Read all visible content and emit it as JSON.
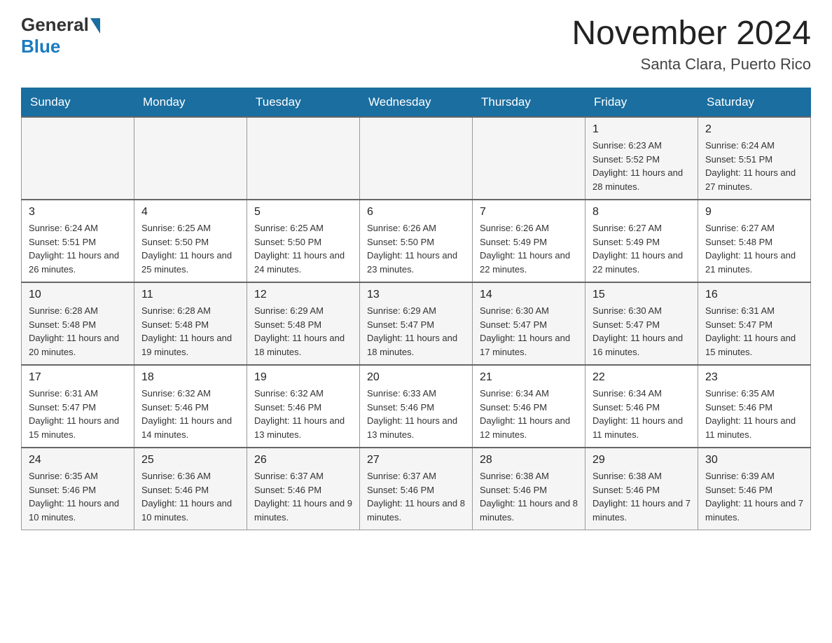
{
  "header": {
    "logo": {
      "general": "General",
      "blue": "Blue"
    },
    "title": "November 2024",
    "location": "Santa Clara, Puerto Rico"
  },
  "calendar": {
    "days_of_week": [
      "Sunday",
      "Monday",
      "Tuesday",
      "Wednesday",
      "Thursday",
      "Friday",
      "Saturday"
    ],
    "weeks": [
      {
        "days": [
          {
            "num": "",
            "info": ""
          },
          {
            "num": "",
            "info": ""
          },
          {
            "num": "",
            "info": ""
          },
          {
            "num": "",
            "info": ""
          },
          {
            "num": "",
            "info": ""
          },
          {
            "num": "1",
            "info": "Sunrise: 6:23 AM\nSunset: 5:52 PM\nDaylight: 11 hours and 28 minutes."
          },
          {
            "num": "2",
            "info": "Sunrise: 6:24 AM\nSunset: 5:51 PM\nDaylight: 11 hours and 27 minutes."
          }
        ]
      },
      {
        "days": [
          {
            "num": "3",
            "info": "Sunrise: 6:24 AM\nSunset: 5:51 PM\nDaylight: 11 hours and 26 minutes."
          },
          {
            "num": "4",
            "info": "Sunrise: 6:25 AM\nSunset: 5:50 PM\nDaylight: 11 hours and 25 minutes."
          },
          {
            "num": "5",
            "info": "Sunrise: 6:25 AM\nSunset: 5:50 PM\nDaylight: 11 hours and 24 minutes."
          },
          {
            "num": "6",
            "info": "Sunrise: 6:26 AM\nSunset: 5:50 PM\nDaylight: 11 hours and 23 minutes."
          },
          {
            "num": "7",
            "info": "Sunrise: 6:26 AM\nSunset: 5:49 PM\nDaylight: 11 hours and 22 minutes."
          },
          {
            "num": "8",
            "info": "Sunrise: 6:27 AM\nSunset: 5:49 PM\nDaylight: 11 hours and 22 minutes."
          },
          {
            "num": "9",
            "info": "Sunrise: 6:27 AM\nSunset: 5:48 PM\nDaylight: 11 hours and 21 minutes."
          }
        ]
      },
      {
        "days": [
          {
            "num": "10",
            "info": "Sunrise: 6:28 AM\nSunset: 5:48 PM\nDaylight: 11 hours and 20 minutes."
          },
          {
            "num": "11",
            "info": "Sunrise: 6:28 AM\nSunset: 5:48 PM\nDaylight: 11 hours and 19 minutes."
          },
          {
            "num": "12",
            "info": "Sunrise: 6:29 AM\nSunset: 5:48 PM\nDaylight: 11 hours and 18 minutes."
          },
          {
            "num": "13",
            "info": "Sunrise: 6:29 AM\nSunset: 5:47 PM\nDaylight: 11 hours and 18 minutes."
          },
          {
            "num": "14",
            "info": "Sunrise: 6:30 AM\nSunset: 5:47 PM\nDaylight: 11 hours and 17 minutes."
          },
          {
            "num": "15",
            "info": "Sunrise: 6:30 AM\nSunset: 5:47 PM\nDaylight: 11 hours and 16 minutes."
          },
          {
            "num": "16",
            "info": "Sunrise: 6:31 AM\nSunset: 5:47 PM\nDaylight: 11 hours and 15 minutes."
          }
        ]
      },
      {
        "days": [
          {
            "num": "17",
            "info": "Sunrise: 6:31 AM\nSunset: 5:47 PM\nDaylight: 11 hours and 15 minutes."
          },
          {
            "num": "18",
            "info": "Sunrise: 6:32 AM\nSunset: 5:46 PM\nDaylight: 11 hours and 14 minutes."
          },
          {
            "num": "19",
            "info": "Sunrise: 6:32 AM\nSunset: 5:46 PM\nDaylight: 11 hours and 13 minutes."
          },
          {
            "num": "20",
            "info": "Sunrise: 6:33 AM\nSunset: 5:46 PM\nDaylight: 11 hours and 13 minutes."
          },
          {
            "num": "21",
            "info": "Sunrise: 6:34 AM\nSunset: 5:46 PM\nDaylight: 11 hours and 12 minutes."
          },
          {
            "num": "22",
            "info": "Sunrise: 6:34 AM\nSunset: 5:46 PM\nDaylight: 11 hours and 11 minutes."
          },
          {
            "num": "23",
            "info": "Sunrise: 6:35 AM\nSunset: 5:46 PM\nDaylight: 11 hours and 11 minutes."
          }
        ]
      },
      {
        "days": [
          {
            "num": "24",
            "info": "Sunrise: 6:35 AM\nSunset: 5:46 PM\nDaylight: 11 hours and 10 minutes."
          },
          {
            "num": "25",
            "info": "Sunrise: 6:36 AM\nSunset: 5:46 PM\nDaylight: 11 hours and 10 minutes."
          },
          {
            "num": "26",
            "info": "Sunrise: 6:37 AM\nSunset: 5:46 PM\nDaylight: 11 hours and 9 minutes."
          },
          {
            "num": "27",
            "info": "Sunrise: 6:37 AM\nSunset: 5:46 PM\nDaylight: 11 hours and 8 minutes."
          },
          {
            "num": "28",
            "info": "Sunrise: 6:38 AM\nSunset: 5:46 PM\nDaylight: 11 hours and 8 minutes."
          },
          {
            "num": "29",
            "info": "Sunrise: 6:38 AM\nSunset: 5:46 PM\nDaylight: 11 hours and 7 minutes."
          },
          {
            "num": "30",
            "info": "Sunrise: 6:39 AM\nSunset: 5:46 PM\nDaylight: 11 hours and 7 minutes."
          }
        ]
      }
    ]
  }
}
